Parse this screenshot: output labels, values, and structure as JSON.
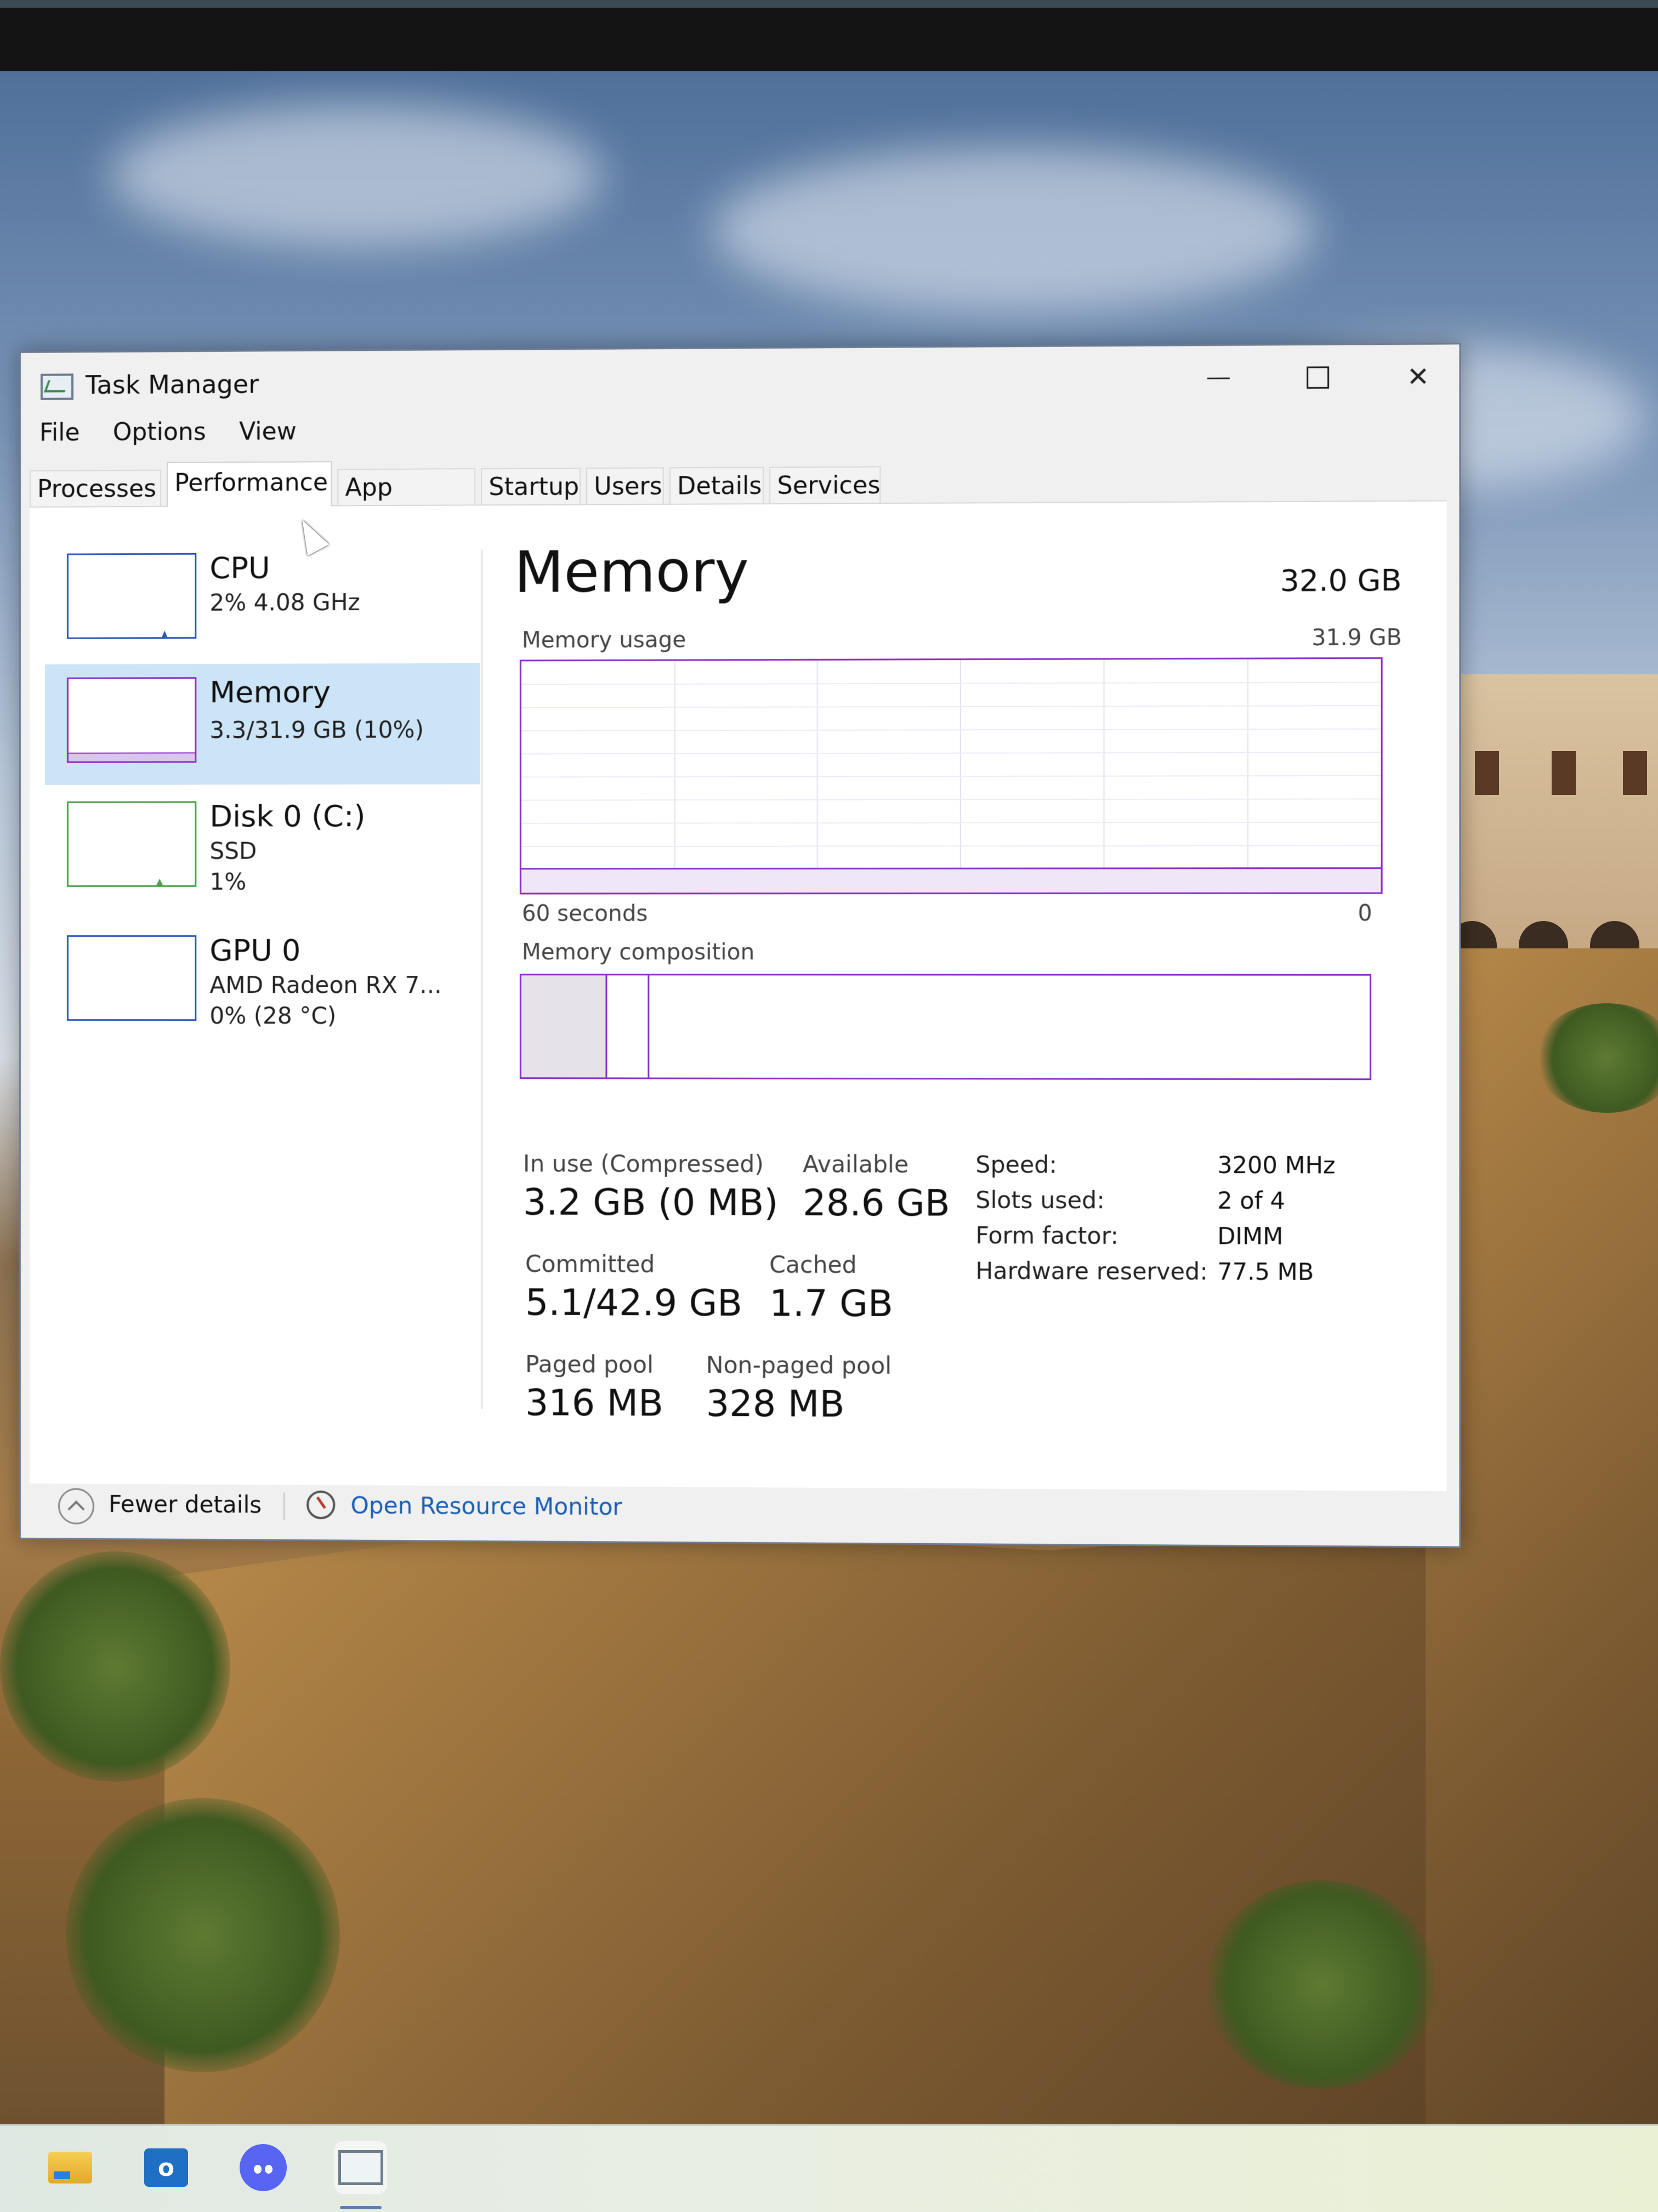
{
  "window": {
    "title": "Task Manager",
    "menu": [
      "File",
      "Options",
      "View"
    ],
    "tabs": [
      "Processes",
      "Performance",
      "App history",
      "Startup",
      "Users",
      "Details",
      "Services"
    ],
    "active_tab": "Performance"
  },
  "sidebar": {
    "items": [
      {
        "name": "CPU",
        "line1": "2%  4.08 GHz",
        "line2": ""
      },
      {
        "name": "Memory",
        "line1": "3.3/31.9 GB (10%)",
        "line2": ""
      },
      {
        "name": "Disk 0 (C:)",
        "line1": "SSD",
        "line2": "1%"
      },
      {
        "name": "GPU 0",
        "line1": "AMD Radeon RX 7...",
        "line2": "0%  (28 °C)"
      }
    ],
    "selected": "Memory"
  },
  "memory": {
    "title": "Memory",
    "total": "32.0 GB",
    "usage_label": "Memory usage",
    "usage_max": "31.9 GB",
    "time_left": "60 seconds",
    "time_right": "0",
    "usage_fraction": 0.1,
    "composition_label": "Memory composition",
    "composition": {
      "in_use_fraction": 0.1,
      "modified_fraction": 0.05
    },
    "stats": {
      "in_use_label": "In use (Compressed)",
      "in_use_value": "3.2 GB (0 MB)",
      "available_label": "Available",
      "available_value": "28.6 GB",
      "committed_label": "Committed",
      "committed_value": "5.1/42.9 GB",
      "cached_label": "Cached",
      "cached_value": "1.7 GB",
      "paged_label": "Paged pool",
      "paged_value": "316 MB",
      "nonpaged_label": "Non-paged pool",
      "nonpaged_value": "328 MB"
    },
    "specs": [
      {
        "label": "Speed:",
        "value": "3200 MHz"
      },
      {
        "label": "Slots used:",
        "value": "2 of 4"
      },
      {
        "label": "Form factor:",
        "value": "DIMM"
      },
      {
        "label": "Hardware reserved:",
        "value": "77.5 MB"
      }
    ]
  },
  "footer": {
    "fewer_details": "Fewer details",
    "resource_monitor": "Open Resource Monitor"
  },
  "colors": {
    "memory_accent": "#8b2fc9",
    "cpu_accent": "#2c57b6",
    "disk_accent": "#4ba04b",
    "selected_bg": "#cce4f7",
    "link": "#1a5fb4"
  },
  "taskbar": {
    "icons": [
      "file-explorer-icon",
      "outlook-icon",
      "discord-icon",
      "task-manager-icon"
    ]
  }
}
